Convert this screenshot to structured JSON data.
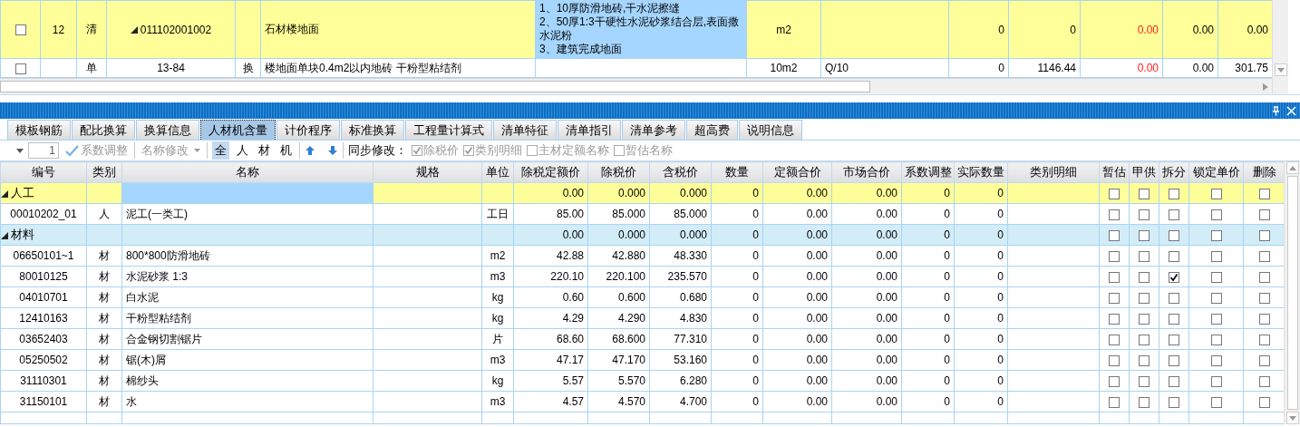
{
  "upper_grid": {
    "rows": [
      {
        "kind": "bill",
        "checked": false,
        "number": "12",
        "type": "清",
        "expanded": true,
        "code": "011102001002",
        "name": "石材楼地面",
        "features": [
          "1、10厚防滑地砖,干水泥擦缝",
          "2、50厚1:3干硬性水泥砂浆结合层,表面撒水泥粉",
          "3、建筑完成地面"
        ],
        "features_focused": true,
        "unit": "m2",
        "column_10": "0",
        "column_11": "0",
        "column_12": "0.00",
        "column_13": "0.00",
        "column_14": "0.00"
      },
      {
        "kind": "quota",
        "checked": false,
        "type": "单",
        "code": "13-84",
        "change": "换",
        "name": "楼地面单块0.4m2以内地砖 干粉型粘结剂",
        "features_focused": false,
        "unit": "10m2",
        "quantity_expr": "Q/10",
        "column_10": "0",
        "column_11": "1146.44",
        "column_12": "0.00",
        "column_13": "0.00",
        "column_14": "301.75"
      }
    ]
  },
  "tabs": [
    {
      "label": "模板钢筋",
      "selected": false
    },
    {
      "label": "配比换算",
      "selected": false
    },
    {
      "label": "换算信息",
      "selected": false
    },
    {
      "label": "人材机含量",
      "selected": true
    },
    {
      "label": "计价程序",
      "selected": false
    },
    {
      "label": "标准换算",
      "selected": false
    },
    {
      "label": "工程量计算式",
      "selected": false
    },
    {
      "label": "清单特征",
      "selected": false
    },
    {
      "label": "清单指引",
      "selected": false
    },
    {
      "label": "清单参考",
      "selected": false
    },
    {
      "label": "超高费",
      "selected": false
    },
    {
      "label": "说明信息",
      "selected": false
    }
  ],
  "toolbar": {
    "spin_value": "1",
    "coefficient_button": {
      "label": "系数调整",
      "disabled": true
    },
    "rename_button": {
      "label": "名称修改",
      "disabled": true
    },
    "filters": [
      {
        "label": "全",
        "selected": true
      },
      {
        "label": "人",
        "selected": false
      },
      {
        "label": "材",
        "selected": false
      },
      {
        "label": "机",
        "selected": false
      }
    ],
    "sync_label": "同步修改：",
    "sync_options": [
      {
        "label": "除税价",
        "checked": true,
        "disabled": true
      },
      {
        "label": "类别明细",
        "checked": true,
        "disabled": true
      },
      {
        "label": "主材定额名称",
        "checked": false,
        "disabled": true
      },
      {
        "label": "暂估名称",
        "checked": false,
        "disabled": true
      }
    ]
  },
  "material_grid": {
    "columns": [
      "编号",
      "类别",
      "名称",
      "规格",
      "单位",
      "除税定额价",
      "除税价",
      "含税价",
      "数量",
      "定额合价",
      "市场合价",
      "系数调整",
      "实际数量",
      "类别明细",
      "暂估",
      "甲供",
      "拆分",
      "锁定单价",
      "删除"
    ],
    "groups": [
      {
        "label": "人工",
        "expanded": true,
        "selected": true,
        "name_focused": true,
        "quota_price_ex_tax": "0.00",
        "price_ex_tax": "0.000",
        "price_inc_tax": "0.000",
        "quantity": "0",
        "quota_total": "0.00",
        "market_total": "0.00",
        "coefficient": "0",
        "actual_quantity": "0",
        "provisional": false,
        "owner_supplied": false,
        "split": false,
        "lock_price": false,
        "delete": false,
        "children": [
          {
            "code": "00010202_01",
            "type": "人",
            "name": "泥工(一类工)",
            "unit": "工日",
            "quota_price_ex_tax": "85.00",
            "price_ex_tax": "85.000",
            "price_inc_tax": "85.000",
            "quantity": "0",
            "quota_total": "0.00",
            "market_total": "0.00",
            "coefficient": "0",
            "actual_quantity": "0",
            "provisional": false,
            "owner_supplied": false,
            "split": false,
            "lock_price": false,
            "delete": false
          }
        ]
      },
      {
        "label": "材料",
        "expanded": true,
        "selected": false,
        "name_focused": false,
        "quota_price_ex_tax": "0.00",
        "price_ex_tax": "0.000",
        "price_inc_tax": "0.000",
        "quantity": "0",
        "quota_total": "0.00",
        "market_total": "0.00",
        "coefficient": "0",
        "actual_quantity": "0",
        "provisional": false,
        "owner_supplied": false,
        "split": false,
        "lock_price": false,
        "delete": false,
        "children": [
          {
            "code": "06650101~1",
            "type": "材",
            "name": "800*800防滑地砖",
            "unit": "m2",
            "quota_price_ex_tax": "42.88",
            "price_ex_tax": "42.880",
            "price_inc_tax": "48.330",
            "quantity": "0",
            "quota_total": "0.00",
            "market_total": "0.00",
            "coefficient": "0",
            "actual_quantity": "0",
            "provisional": false,
            "owner_supplied": false,
            "split": false,
            "lock_price": false,
            "delete": false
          },
          {
            "code": "80010125",
            "type": "材",
            "name": "水泥砂浆 1:3",
            "unit": "m3",
            "quota_price_ex_tax": "220.10",
            "price_ex_tax": "220.100",
            "price_inc_tax": "235.570",
            "quantity": "0",
            "quota_total": "0.00",
            "market_total": "0.00",
            "coefficient": "0",
            "actual_quantity": "0",
            "provisional": false,
            "owner_supplied": false,
            "split": true,
            "lock_price": false,
            "delete": false
          },
          {
            "code": "04010701",
            "type": "材",
            "name": "白水泥",
            "unit": "kg",
            "quota_price_ex_tax": "0.60",
            "price_ex_tax": "0.600",
            "price_inc_tax": "0.680",
            "quantity": "0",
            "quota_total": "0.00",
            "market_total": "0.00",
            "coefficient": "0",
            "actual_quantity": "0",
            "provisional": false,
            "owner_supplied": false,
            "split": false,
            "lock_price": false,
            "delete": false
          },
          {
            "code": "12410163",
            "type": "材",
            "name": "干粉型粘结剂",
            "unit": "kg",
            "quota_price_ex_tax": "4.29",
            "price_ex_tax": "4.290",
            "price_inc_tax": "4.830",
            "quantity": "0",
            "quota_total": "0.00",
            "market_total": "0.00",
            "coefficient": "0",
            "actual_quantity": "0",
            "provisional": false,
            "owner_supplied": false,
            "split": false,
            "lock_price": false,
            "delete": false
          },
          {
            "code": "03652403",
            "type": "材",
            "name": "合金钢切割锯片",
            "unit": "片",
            "quota_price_ex_tax": "68.60",
            "price_ex_tax": "68.600",
            "price_inc_tax": "77.310",
            "quantity": "0",
            "quota_total": "0.00",
            "market_total": "0.00",
            "coefficient": "0",
            "actual_quantity": "0",
            "provisional": false,
            "owner_supplied": false,
            "split": false,
            "lock_price": false,
            "delete": false
          },
          {
            "code": "05250502",
            "type": "材",
            "name": "锯(木)屑",
            "unit": "m3",
            "quota_price_ex_tax": "47.17",
            "price_ex_tax": "47.170",
            "price_inc_tax": "53.160",
            "quantity": "0",
            "quota_total": "0.00",
            "market_total": "0.00",
            "coefficient": "0",
            "actual_quantity": "0",
            "provisional": false,
            "owner_supplied": false,
            "split": false,
            "lock_price": false,
            "delete": false
          },
          {
            "code": "31110301",
            "type": "材",
            "name": "棉纱头",
            "unit": "kg",
            "quota_price_ex_tax": "5.57",
            "price_ex_tax": "5.570",
            "price_inc_tax": "6.280",
            "quantity": "0",
            "quota_total": "0.00",
            "market_total": "0.00",
            "coefficient": "0",
            "actual_quantity": "0",
            "provisional": false,
            "owner_supplied": false,
            "split": false,
            "lock_price": false,
            "delete": false
          },
          {
            "code": "31150101",
            "type": "材",
            "name": "水",
            "unit": "m3",
            "quota_price_ex_tax": "4.57",
            "price_ex_tax": "4.570",
            "price_inc_tax": "4.700",
            "quantity": "0",
            "quota_total": "0.00",
            "market_total": "0.00",
            "coefficient": "0",
            "actual_quantity": "0",
            "provisional": false,
            "owner_supplied": false,
            "split": false,
            "lock_price": false,
            "delete": false
          }
        ]
      }
    ]
  }
}
